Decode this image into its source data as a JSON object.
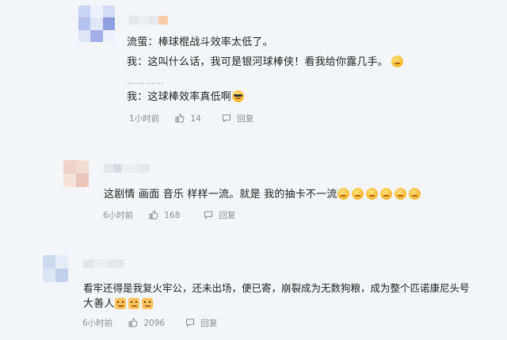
{
  "comments": [
    {
      "lines": [
        "流萤：棒球棍战斗效率太低了。",
        "我：这叫什么话，我可是银河球棒侠！看我给你露几手。",
        "我：这球棒效率真低啊"
      ],
      "ellipsis": "…………",
      "time": "1小时前",
      "likes": "14",
      "reply_label": "回复"
    },
    {
      "lines": [
        "这剧情 画面 音乐 样样一流。就是 我的抽卡不一流"
      ],
      "time": "6小时前",
      "likes": "168",
      "reply_label": "回复"
    },
    {
      "lines": [
        "看牢还得是我复火牢公，还未出场，便已寄，崩裂成为无数狗粮，成为整个匹诺康尼头号",
        "大善人"
      ],
      "time": "6小时前",
      "likes": "2096",
      "reply_label": "回复"
    }
  ],
  "colors": {
    "background": "#f4f5f8",
    "text": "#1f1f1f",
    "meta": "#8a8d93",
    "emoji": "#f5b72e"
  },
  "icons": [
    "thumb-up-icon",
    "comment-icon",
    "smile-emoji",
    "cool-emoji",
    "dog-emoji"
  ]
}
